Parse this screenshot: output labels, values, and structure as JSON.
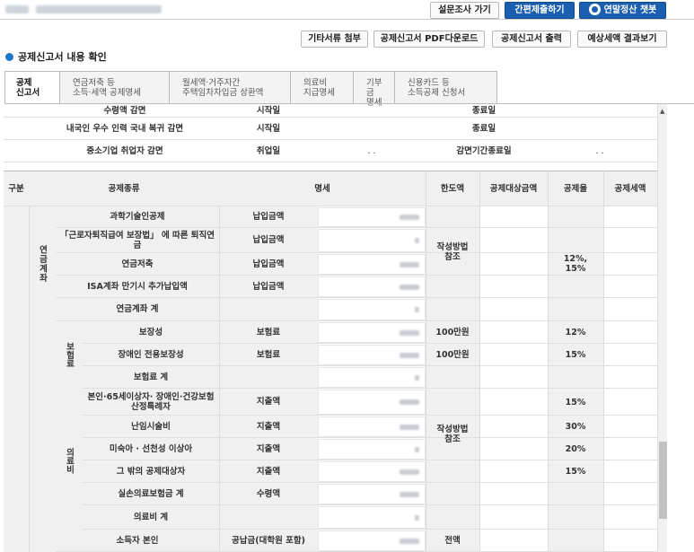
{
  "top_buttons": {
    "survey": "설문조사 가기",
    "simple_submit": "간편제출하기",
    "chatbot": "연말정산 챗봇"
  },
  "sub_buttons": {
    "attach": "기타서류 첨부",
    "pdf": "공제신고서 PDF다운로드",
    "print": "공제신고서 출력",
    "estimate": "예상세액 결과보기"
  },
  "page_title": "공제신고서 내용 확인",
  "tabs": [
    {
      "l1": "공제",
      "l2": "신고서"
    },
    {
      "l1": "연금저축 등",
      "l2": "소득·세액 공제명세"
    },
    {
      "l1": "월세액·거주자간",
      "l2": "주택임차차입금 상환액"
    },
    {
      "l1": "의료비",
      "l2": "지급명세"
    },
    {
      "l1": "기부금",
      "l2": "명세"
    },
    {
      "l1": "신용카드 등",
      "l2": "소득공제 신청서"
    }
  ],
  "upper": {
    "r1": {
      "name": "수령액 감면",
      "col": "시작일",
      "end": "종료일"
    },
    "r2": {
      "name": "내국인 우수 인력 국내 복귀 감면",
      "col": "시작일",
      "end": "종료일"
    },
    "r3": {
      "name": "중소기업 취업자 감면",
      "col": "취업일",
      "dots": ". .",
      "end": "감면기간종료일",
      "dots2": ". ."
    }
  },
  "header": {
    "gubun": "구분",
    "type": "공제종류",
    "detail": "명세",
    "limit": "한도액",
    "target": "공제대상금액",
    "rate": "공제율",
    "amount": "공제세액"
  },
  "groups": {
    "pension": "연금계좌",
    "insurance": "보험료",
    "medical": "의료비"
  },
  "rows": [
    {
      "name": "과학기술인공제",
      "kind": "납입금액"
    },
    {
      "name": "「근로자퇴직급여 보장법」 에 따른 퇴직연금",
      "kind": "납입금액"
    },
    {
      "name": "연금저축",
      "kind": "납입금액"
    },
    {
      "name": "ISA계좌 만기시 추가납입액",
      "kind": "납입금액"
    },
    {
      "name": "연금계좌 계",
      "kind": ""
    },
    {
      "name": "보장성",
      "kind": "보험료"
    },
    {
      "name": "장애인 전용보장성",
      "kind": "보험료"
    },
    {
      "name": "보험료 계",
      "kind": ""
    },
    {
      "name": "본인·65세이상자· 장애인·건강보험산정특례자",
      "kind": "지출액"
    },
    {
      "name": "난임시술비",
      "kind": "지출액"
    },
    {
      "name": "미숙아 · 선천성 이상아",
      "kind": "지출액"
    },
    {
      "name": "그 밖의 공제대상자",
      "kind": "지출액"
    },
    {
      "name": "실손의료보험금 계",
      "kind": "수령액"
    },
    {
      "name": "의료비 계",
      "kind": ""
    },
    {
      "name": "소득자 본인",
      "kind": "공납금(대학원 포함)"
    }
  ],
  "merged": {
    "pension_limit": "작성방법 참조",
    "pension_rate": "12%, 15%",
    "ins_limit1": "100만원",
    "ins_rate1": "12%",
    "ins_limit2": "100만원",
    "ins_rate2": "15%",
    "med_limit": "작성방법 참조",
    "med_rate1": "15%",
    "med_rate2": "30%",
    "med_rate3": "20%",
    "med_rate4": "15%",
    "edu_limit": "전액"
  }
}
